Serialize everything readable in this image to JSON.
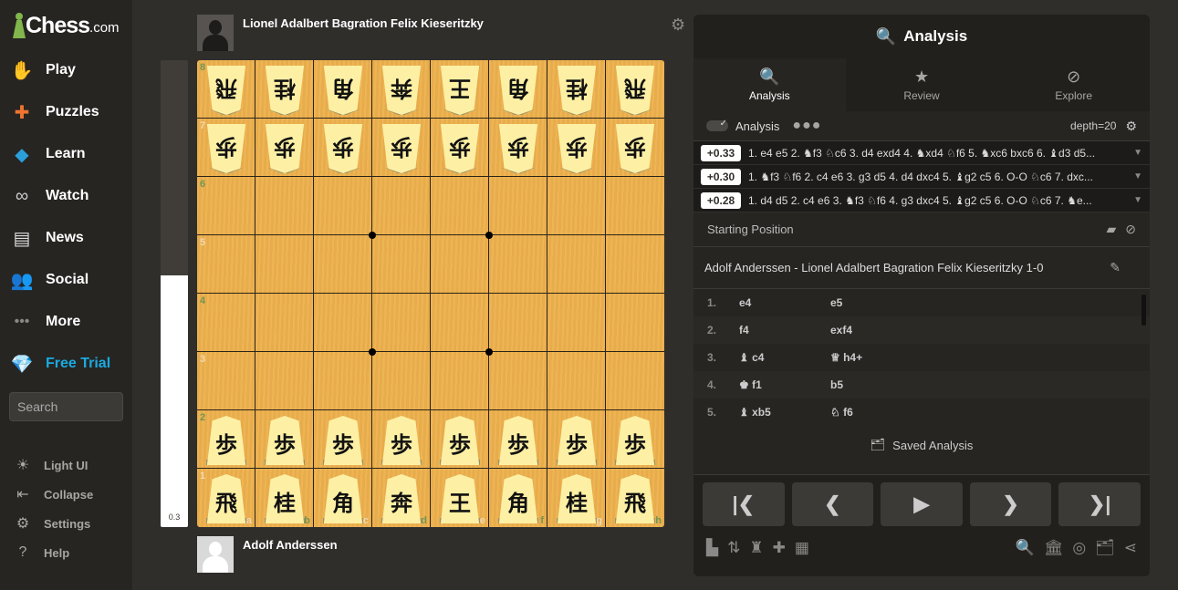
{
  "sidebar": {
    "logo": {
      "main": "Chess",
      "suffix": ".com"
    },
    "nav": [
      {
        "label": "Play",
        "icon": "play-hand-icon"
      },
      {
        "label": "Puzzles",
        "icon": "puzzle-icon"
      },
      {
        "label": "Learn",
        "icon": "graduation-cap-icon"
      },
      {
        "label": "Watch",
        "icon": "binoculars-icon"
      },
      {
        "label": "News",
        "icon": "newspaper-icon"
      },
      {
        "label": "Social",
        "icon": "people-icon"
      },
      {
        "label": "More",
        "icon": "dots-icon"
      },
      {
        "label": "Free Trial",
        "icon": "diamond-icon"
      }
    ],
    "search_placeholder": "Search",
    "bottom": [
      {
        "label": "Light UI",
        "icon": "brightness-icon"
      },
      {
        "label": "Collapse",
        "icon": "collapse-icon"
      },
      {
        "label": "Settings",
        "icon": "gear-icon"
      },
      {
        "label": "Help",
        "icon": "help-icon"
      }
    ],
    "accent": "#1baae1"
  },
  "players": {
    "top": {
      "name": "Lionel Adalbert Bagration Felix Kieseritzky"
    },
    "bottom": {
      "name": "Adolf Anderssen"
    }
  },
  "eval_bar": {
    "value": "0.3",
    "white_fraction": 0.54
  },
  "board": {
    "ranks": [
      "8",
      "7",
      "6",
      "5",
      "4",
      "3",
      "2",
      "1"
    ],
    "files": [
      "a",
      "b",
      "c",
      "d",
      "e",
      "f",
      "g",
      "h"
    ],
    "rows": [
      {
        "rank": "8",
        "pieces": [
          "飛",
          "桂",
          "角",
          "奔",
          "王",
          "角",
          "桂",
          "飛"
        ],
        "orientation": "down"
      },
      {
        "rank": "7",
        "pieces": [
          "歩",
          "歩",
          "歩",
          "歩",
          "歩",
          "歩",
          "歩",
          "歩"
        ],
        "orientation": "down"
      },
      {
        "rank": "6",
        "pieces": [],
        "orientation": ""
      },
      {
        "rank": "5",
        "pieces": [],
        "orientation": ""
      },
      {
        "rank": "4",
        "pieces": [],
        "orientation": ""
      },
      {
        "rank": "3",
        "pieces": [],
        "orientation": ""
      },
      {
        "rank": "2",
        "pieces": [
          "歩",
          "歩",
          "歩",
          "歩",
          "歩",
          "歩",
          "歩",
          "歩"
        ],
        "orientation": "up"
      },
      {
        "rank": "1",
        "pieces": [
          "飛",
          "桂",
          "角",
          "奔",
          "王",
          "角",
          "桂",
          "飛"
        ],
        "orientation": "up"
      }
    ],
    "light_coord_color": "#f0d9b5",
    "dark_coord_color": "#739552"
  },
  "panel": {
    "title": "Analysis",
    "tabs": [
      {
        "label": "Analysis",
        "icon": "analysis-magnifier-icon",
        "active": true
      },
      {
        "label": "Review",
        "icon": "star-icon",
        "active": false
      },
      {
        "label": "Explore",
        "icon": "compass-icon",
        "active": false
      }
    ],
    "engine": {
      "label": "Analysis",
      "enabled": true,
      "depth": "depth=20"
    },
    "lines": [
      {
        "score": "+0.33",
        "moves": "1. e4 e5 2. ♞f3 ♘c6 3. d4 exd4 4. ♞xd4 ♘f6 5. ♞xc6 bxc6 6. ♝d3 d5..."
      },
      {
        "score": "+0.30",
        "moves": "1. ♞f3 ♘f6 2. c4 e6 3. g3 d5 4. d4 dxc4 5. ♝g2 c5 6. O-O ♘c6 7. dxc..."
      },
      {
        "score": "+0.28",
        "moves": "1. d4 d5 2. c4 e6 3. ♞f3 ♘f6 4. g3 dxc4 5. ♝g2 c5 6. O-O ♘c6 7. ♞e..."
      }
    ],
    "opening": "Starting Position",
    "game_title": "Adolf Anderssen  -  Lionel Adalbert Bagration Felix Kieseritzky  1-0",
    "moves": [
      {
        "num": "1.",
        "white": "e4",
        "black": "e5"
      },
      {
        "num": "2.",
        "white": "f4",
        "black": "exf4"
      },
      {
        "num": "3.",
        "white": "♝ c4",
        "black": "♕ h4+"
      },
      {
        "num": "4.",
        "white": "♚ f1",
        "black": "b5"
      },
      {
        "num": "5.",
        "white": "♝ xb5",
        "black": "♘ f6"
      }
    ],
    "saved_analysis": "Saved Analysis",
    "controls": [
      "first-move",
      "previous-move",
      "play",
      "next-move",
      "last-move"
    ]
  }
}
